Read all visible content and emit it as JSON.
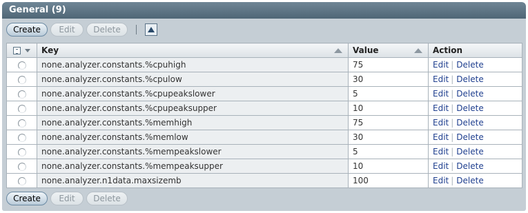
{
  "panel": {
    "title": "General (9)"
  },
  "toolbar": {
    "create_label": "Create",
    "edit_label": "Edit",
    "delete_label": "Delete"
  },
  "table": {
    "columns": {
      "key": "Key",
      "value": "Value",
      "action": "Action"
    },
    "rows": [
      {
        "key": "none.analyzer.constants.%cpuhigh",
        "value": "75",
        "edit": "Edit",
        "delete": "Delete"
      },
      {
        "key": "none.analyzer.constants.%cpulow",
        "value": "30",
        "edit": "Edit",
        "delete": "Delete"
      },
      {
        "key": "none.analyzer.constants.%cpupeakslower",
        "value": "5",
        "edit": "Edit",
        "delete": "Delete"
      },
      {
        "key": "none.analyzer.constants.%cpupeaksupper",
        "value": "10",
        "edit": "Edit",
        "delete": "Delete"
      },
      {
        "key": "none.analyzer.constants.%memhigh",
        "value": "75",
        "edit": "Edit",
        "delete": "Delete"
      },
      {
        "key": "none.analyzer.constants.%memlow",
        "value": "30",
        "edit": "Edit",
        "delete": "Delete"
      },
      {
        "key": "none.analyzer.constants.%mempeakslower",
        "value": "5",
        "edit": "Edit",
        "delete": "Delete"
      },
      {
        "key": "none.analyzer.constants.%mempeaksupper",
        "value": "10",
        "edit": "Edit",
        "delete": "Delete"
      },
      {
        "key": "none.analyzer.n1data.maxsizemb",
        "value": "100",
        "edit": "Edit",
        "delete": "Delete"
      }
    ]
  }
}
